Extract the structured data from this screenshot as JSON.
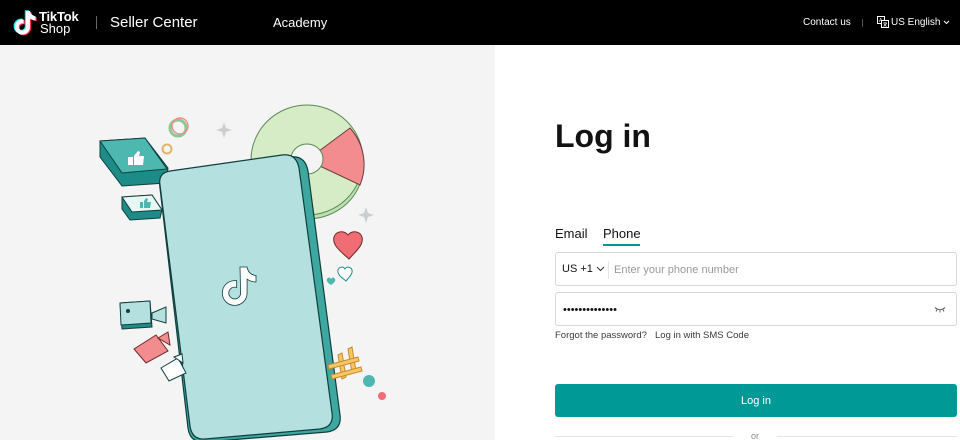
{
  "header": {
    "logo_line1": "TikTok",
    "logo_line2": "Shop",
    "title": "Seller Center",
    "nav_academy": "Academy",
    "contact": "Contact us",
    "language": "US English"
  },
  "illustration": {
    "icons": [
      "tiktok-logo-icon",
      "thumbs-up-icon",
      "heart-icon",
      "video-camera-icon",
      "hashtag-icon",
      "pie-chart-icon",
      "sparkle-icon"
    ]
  },
  "login": {
    "title": "Log in",
    "tabs": [
      {
        "label": "Email",
        "active": false
      },
      {
        "label": "Phone",
        "active": true
      }
    ],
    "country_code": "US +1",
    "phone_placeholder": "Enter your phone number",
    "phone_value": "",
    "password_value": "••••••••••••••",
    "forgot_link": "Forgot the password?",
    "sms_link": "Log in with SMS Code",
    "login_button": "Log in",
    "or_text": "or"
  },
  "colors": {
    "accent": "#009995",
    "topbar": "#000000",
    "left_panel_bg": "#f4f4f4",
    "phone_fill": "#b4e0e0",
    "pink": "#f38c8f",
    "light_green": "#d6ecc6"
  }
}
